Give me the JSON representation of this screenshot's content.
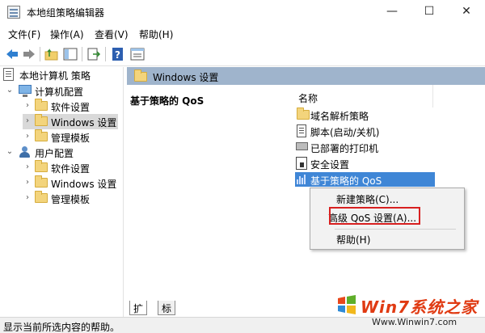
{
  "window": {
    "title": "本地组策略编辑器",
    "minimize": "—",
    "maximize": "☐",
    "close": "✕"
  },
  "menu": {
    "file": "文件(F)",
    "action": "操作(A)",
    "view": "查看(V)",
    "help": "帮助(H)"
  },
  "toolbar": {
    "icons": [
      "back-icon",
      "forward-icon",
      "up-folder-icon",
      "show-hide-tree-icon",
      "export-list-icon",
      "help-icon",
      "properties-icon"
    ]
  },
  "tree": {
    "root": "本地计算机 策略",
    "computer_config": "计算机配置",
    "computer_children": [
      "软件设置",
      "Windows 设置",
      "管理模板"
    ],
    "user_config": "用户配置",
    "user_children": [
      "软件设置",
      "Windows 设置",
      "管理模板"
    ]
  },
  "content": {
    "header": "Windows 设置",
    "description_title": "基于策略的 QoS",
    "column_name": "名称",
    "items": [
      "域名解析策略",
      "脚本(启动/关机)",
      "已部署的打印机",
      "安全设置",
      "基于策略的 QoS"
    ]
  },
  "context_menu": {
    "new_policy": "新建策略(C)...",
    "advanced_qos": "高级 QoS 设置(A)...",
    "help": "帮助(H)"
  },
  "tabs": [
    "扩展",
    "标准"
  ],
  "status": "显示当前所选内容的帮助。",
  "watermark": {
    "brand": "Win7系统之家",
    "url": "Www.Winwin7.com"
  },
  "colors": {
    "selection": "#3f86d6",
    "header_band": "#9fb4cc",
    "highlight_box": "#d82020"
  }
}
